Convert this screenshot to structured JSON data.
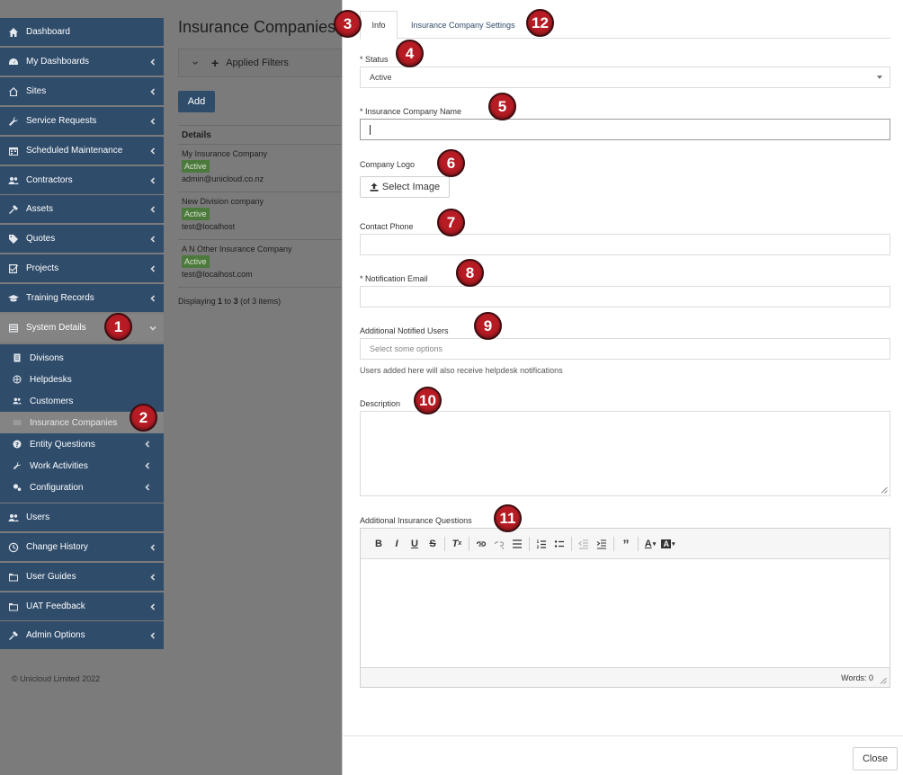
{
  "sidebar": {
    "items": [
      {
        "label": "Dashboard",
        "icon": "home-icon"
      },
      {
        "label": "My Dashboards",
        "icon": "dashboard-icon"
      },
      {
        "label": "Sites",
        "icon": "house-outline-icon"
      },
      {
        "label": "Service Requests",
        "icon": "wrench-icon"
      },
      {
        "label": "Scheduled Maintenance",
        "icon": "calendar-icon"
      },
      {
        "label": "Contractors",
        "icon": "users-icon"
      },
      {
        "label": "Assets",
        "icon": "tools-icon"
      },
      {
        "label": "Quotes",
        "icon": "tag-icon"
      },
      {
        "label": "Projects",
        "icon": "checkbox-icon"
      },
      {
        "label": "Training Records",
        "icon": "graduation-cap-icon"
      },
      {
        "label": "System Details",
        "icon": "list-icon"
      },
      {
        "label": "Users",
        "icon": "users-icon"
      },
      {
        "label": "Change History",
        "icon": "clock-icon"
      },
      {
        "label": "User Guides",
        "icon": "folder-icon"
      },
      {
        "label": "UAT Feedback",
        "icon": "folder-icon"
      },
      {
        "label": "Admin Options",
        "icon": "tools-icon"
      }
    ],
    "submenu": [
      {
        "label": "Divisons",
        "icon": "document-icon"
      },
      {
        "label": "Helpdesks",
        "icon": "globe-icon"
      },
      {
        "label": "Customers",
        "icon": "users-icon"
      },
      {
        "label": "Insurance Companies",
        "icon": "card-icon"
      },
      {
        "label": "Entity Questions",
        "icon": "question-icon"
      },
      {
        "label": "Work Activities",
        "icon": "wrench-icon"
      },
      {
        "label": "Configuration",
        "icon": "gears-icon"
      }
    ],
    "copyright": "© Unicloud Limited 2022"
  },
  "background_page": {
    "title": "Insurance Companies",
    "filters_label": "Applied Filters",
    "add_label": "Add",
    "table_header": "Details",
    "rows": [
      {
        "name": "My Insurance Company",
        "status": "Active",
        "email": "admin@unicloud.co.nz"
      },
      {
        "name": "New Division company",
        "status": "Active",
        "email": "test@localhost"
      },
      {
        "name": "A N Other Insurance Company",
        "status": "Active",
        "email": "test@localhost.com"
      }
    ],
    "count_prefix": "Displaying ",
    "count_range": "1",
    "count_mid": " to ",
    "count_end": "3",
    "count_suffix": " (of 3 items)"
  },
  "panel": {
    "tabs": [
      {
        "label": "Info"
      },
      {
        "label": "Insurance Company Settings"
      }
    ],
    "status_label": "* Status",
    "status_value": "Active",
    "name_label": "* Insurance Company Name",
    "logo_label": "Company Logo",
    "select_image_label": "Select Image",
    "phone_label": "Contact Phone",
    "email_label": "* Notification Email",
    "users_label": "Additional Notified Users",
    "users_placeholder": "Select some options",
    "users_help": "Users added here will also receive helpdesk notifications",
    "description_label": "Description",
    "questions_label": "Additional Insurance Questions",
    "word_count": "Words: 0",
    "close_label": "Close"
  },
  "markers": [
    "1",
    "2",
    "3",
    "4",
    "5",
    "6",
    "7",
    "8",
    "9",
    "10",
    "11",
    "12"
  ],
  "colors": {
    "sidebar_bg": "#2f4c6b",
    "marker": "#b71c24",
    "active_badge": "#4c7a3c",
    "tab_link": "#2f4c6b"
  }
}
